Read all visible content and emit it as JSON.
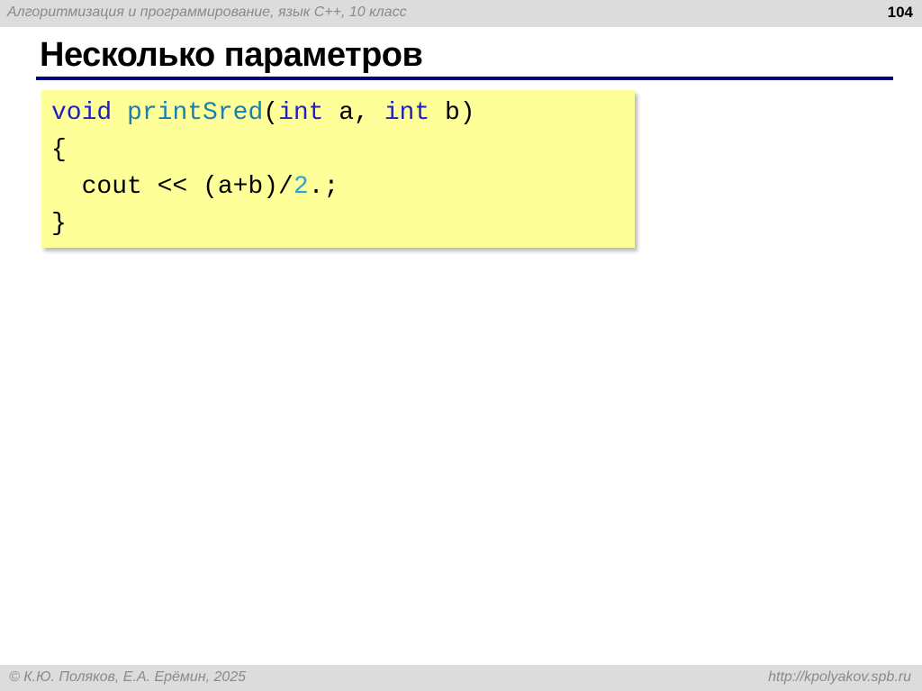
{
  "header": {
    "course": "Алгоритмизация и программирование, язык  C++, 10 класс",
    "page_number": "104"
  },
  "slide": {
    "title": "Несколько параметров"
  },
  "code": {
    "line1": {
      "kw_void": "void",
      "fn": "printSred",
      "p1": "(",
      "kw_int1": "int",
      "a": " a, ",
      "kw_int2": "int",
      "b": " b)"
    },
    "line2": "{",
    "line3": {
      "pre": "  cout << (a+b)/",
      "num": "2",
      "post": ".;"
    },
    "line4": "}"
  },
  "footer": {
    "authors": "© К.Ю. Поляков, Е.А. Ерёмин, 2025",
    "url": "http://kpolyakov.spb.ru"
  },
  "colors": {
    "rule": "#000080",
    "code_bg": "#ffff99",
    "keyword": "#2020c0",
    "function": "#1a7fb0",
    "number": "#1fa8d8"
  }
}
